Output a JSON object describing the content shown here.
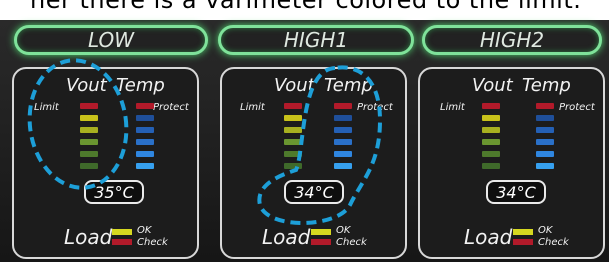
{
  "caption_fragment": "ner there is a varimeter colored to the limit.",
  "modes": [
    "LOW",
    "HIGH1",
    "HIGH2"
  ],
  "cards": [
    {
      "vout": "Vout",
      "temp": "Temp",
      "limit": "Limit",
      "protect": "Protect",
      "temp_value": "35°C",
      "load": "Load",
      "ok": "OK",
      "check": "Check"
    },
    {
      "vout": "Vout",
      "temp": "Temp",
      "limit": "Limit",
      "protect": "Protect",
      "temp_value": "34°C",
      "load": "Load",
      "ok": "OK",
      "check": "Check"
    },
    {
      "vout": "Vout",
      "temp": "Temp",
      "limit": "Limit",
      "protect": "Protect",
      "temp_value": "34°C",
      "load": "Load",
      "ok": "OK",
      "check": "Check"
    }
  ],
  "colors": {
    "button_glow": "#7fe29a",
    "limit_red": "#b21a2a",
    "vout_yellow": "#c8c21a",
    "vout_green": "#4e7a2c",
    "temp_blue": "#2a78d4",
    "annotation_blue": "#1d9fd8"
  }
}
